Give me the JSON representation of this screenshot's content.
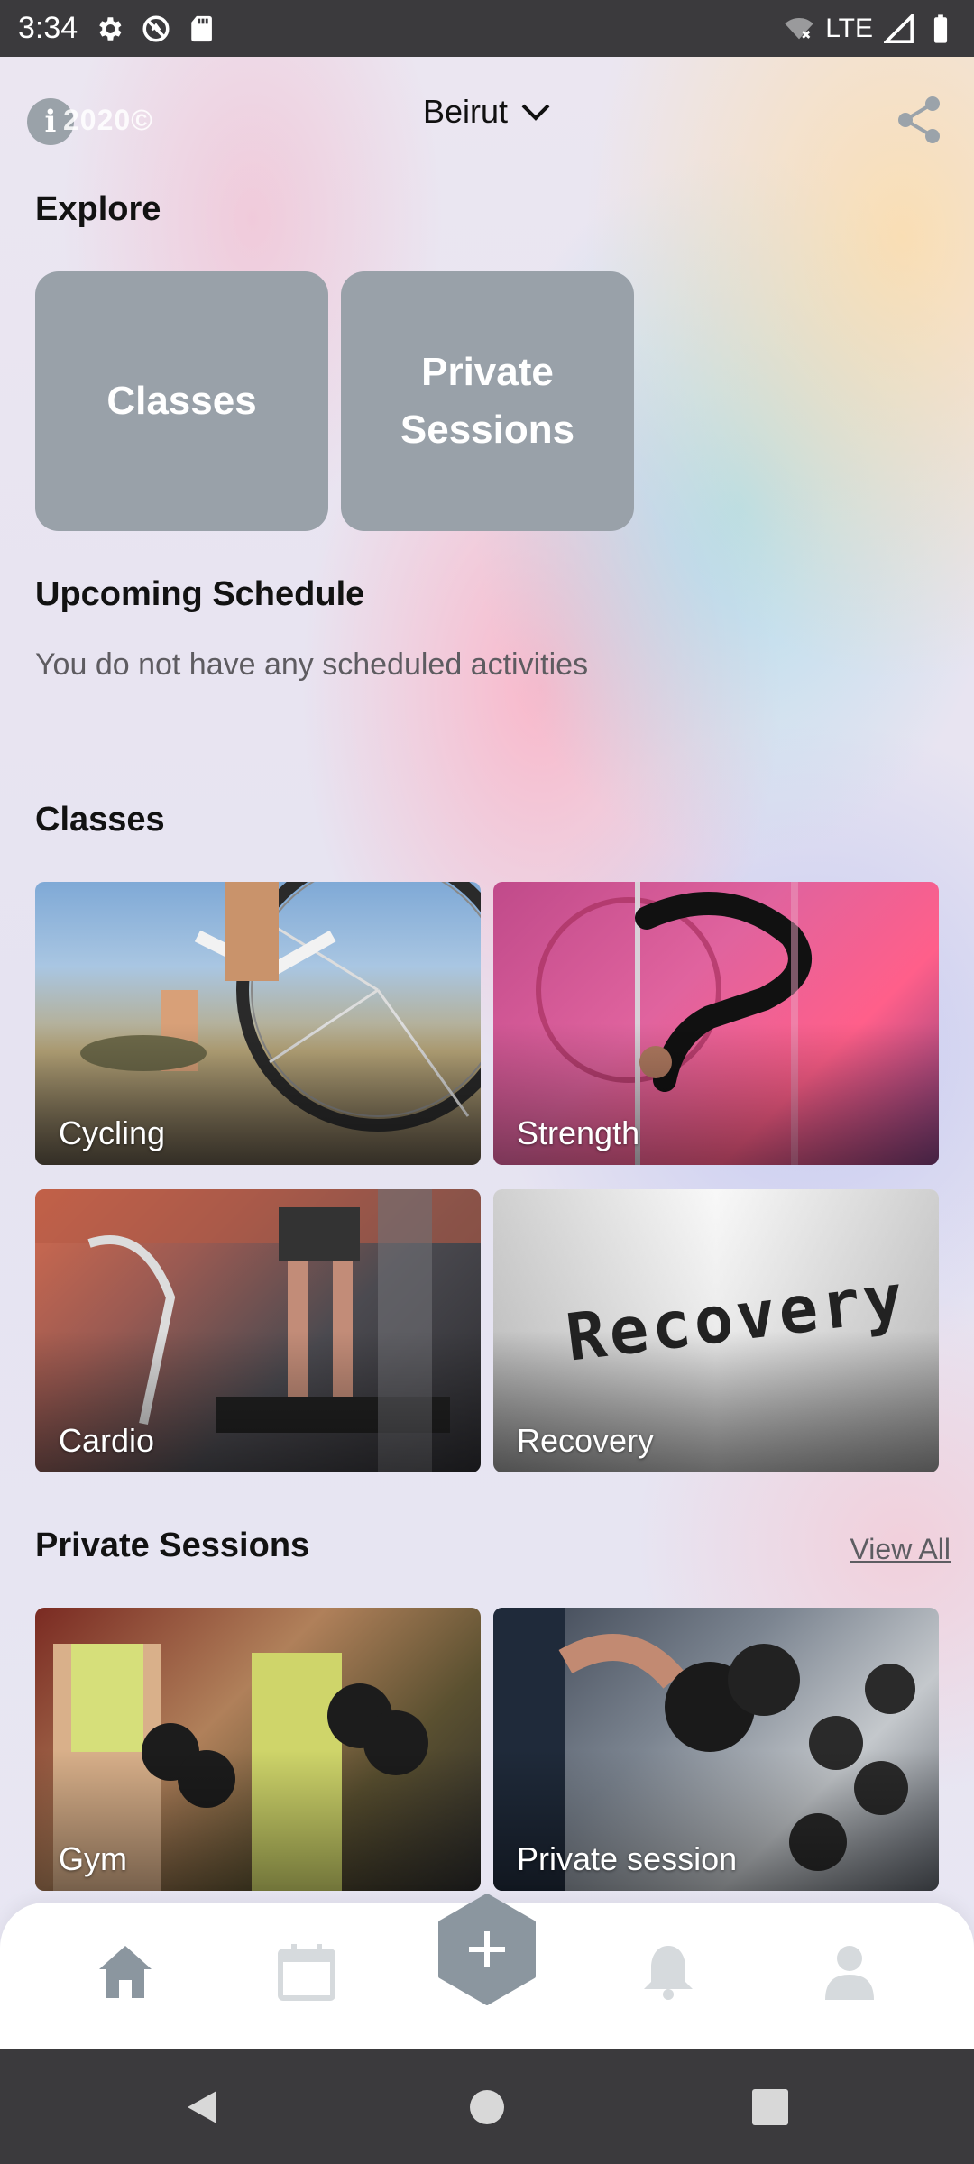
{
  "status_bar": {
    "time": "3:34",
    "network": "LTE"
  },
  "header": {
    "brand": "2020©",
    "location": "Beirut"
  },
  "explore": {
    "title": "Explore",
    "cards": [
      {
        "label": "Classes"
      },
      {
        "label": "Private Sessions"
      }
    ]
  },
  "schedule": {
    "title": "Upcoming Schedule",
    "empty_message": "You do not have any scheduled activities"
  },
  "classes": {
    "title": "Classes",
    "items": [
      {
        "label": "Cycling"
      },
      {
        "label": "Strength"
      },
      {
        "label": "Cardio"
      },
      {
        "label": "Recovery"
      }
    ]
  },
  "private_sessions": {
    "title": "Private Sessions",
    "view_all": "View All",
    "items": [
      {
        "label": "Gym"
      },
      {
        "label": "Private session"
      }
    ]
  },
  "recovery_art_text": "Recovery",
  "colors": {
    "card_gray": "#99a1a9",
    "nav_icon": "#8b969f",
    "nav_icon_inactive": "#d6dadd",
    "status_bar": "#3b3a3d"
  },
  "bottom_nav": {
    "items": [
      {
        "icon": "home-icon"
      },
      {
        "icon": "calendar-icon"
      },
      {
        "icon": "add-icon"
      },
      {
        "icon": "bell-icon"
      },
      {
        "icon": "profile-icon"
      }
    ]
  }
}
